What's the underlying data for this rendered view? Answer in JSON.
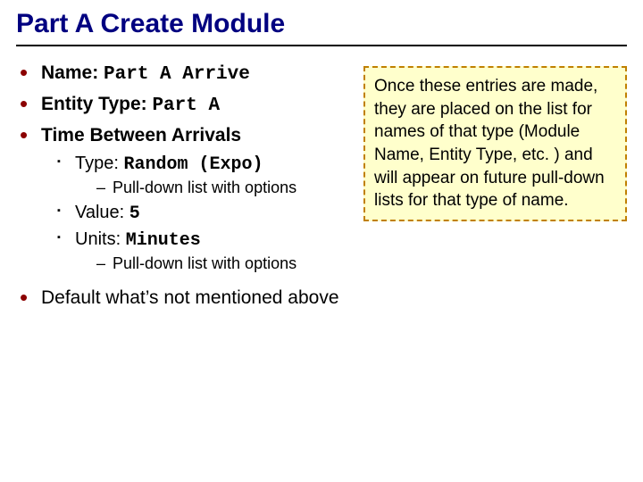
{
  "title": "Part A Create Module",
  "bullets": {
    "name_label": "Name: ",
    "name_value": "Part A Arrive",
    "entity_label": "Entity Type: ",
    "entity_value": "Part A",
    "tba_label": "Time Between Arrivals",
    "type_label": "Type: ",
    "type_value": "Random (Expo)",
    "pulldown1": "Pull-down list with options",
    "value_label": "Value: ",
    "value_value": "5",
    "units_label": "Units: ",
    "units_value": "Minutes",
    "pulldown2": "Pull-down list with options",
    "default": "Default what’s not mentioned above"
  },
  "callout": "Once these entries are made, they are placed on the list for names of that type (Module Name, Entity Type, etc. ) and will appear on future pull-down lists for that type of name."
}
